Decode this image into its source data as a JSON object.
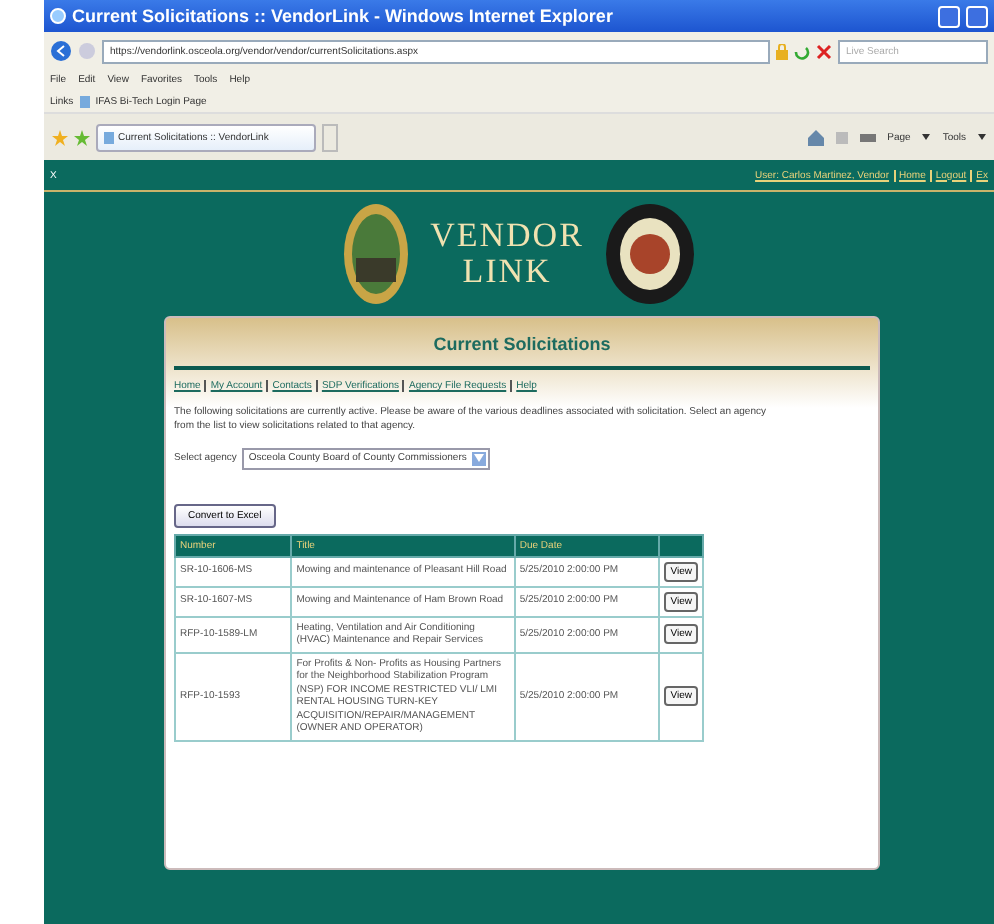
{
  "window": {
    "title": "Current Solicitations :: VendorLink - Windows Internet Explorer"
  },
  "address_bar": {
    "url": "https://vendorlink.osceola.org/vendor/vendor/currentSolicitations.aspx"
  },
  "search": {
    "placeholder": "Live Search"
  },
  "menu": [
    "File",
    "Edit",
    "View",
    "Favorites",
    "Tools",
    "Help"
  ],
  "links_bar": {
    "label": "Links",
    "items": [
      "IFAS Bi-Tech Login Page"
    ]
  },
  "tabs": [
    {
      "label": "Current Solicitations :: VendorLink",
      "selected": true
    }
  ],
  "command_bar": [
    "Page",
    "Tools"
  ],
  "site_header": {
    "mark": "X",
    "user_links": [
      "User: Carlos Martinez, Vendor",
      "Home",
      "Logout",
      "Ex"
    ],
    "logo_lines": [
      "VENDOR",
      "LINK"
    ]
  },
  "panel": {
    "title": "Current Solicitations",
    "nav": [
      "Home",
      "My Account",
      "Contacts",
      "SDP Verifications",
      "Agency File Requests",
      "Help"
    ],
    "intro": "The following solicitations are currently active. Please be aware of the various deadlines associated with solicitation. Select an agency from the list to view solicitations related to that agency.",
    "agency": {
      "label": "Select agency",
      "value": "Osceola County Board of County Commissioners"
    },
    "export_button": "Convert to Excel",
    "table": {
      "columns": [
        "Number",
        "Title",
        "Due Date"
      ],
      "rows": [
        {
          "number": "SR-10-1606-MS",
          "title": "Mowing and maintenance of Pleasant Hill Road",
          "due": "5/25/2010 2:00:00 PM",
          "action": "View"
        },
        {
          "number": "SR-10-1607-MS",
          "title": "Mowing and Maintenance of Ham Brown Road",
          "due": "5/25/2010 2:00:00 PM",
          "action": "View"
        },
        {
          "number": "RFP-10-1589-LM",
          "title": "Heating, Ventilation and Air Conditioning (HVAC) Maintenance and Repair Services",
          "due": "5/25/2010 2:00:00 PM",
          "action": "View"
        },
        {
          "number": "RFP-10-1593",
          "title": "For Profits & Non- Profits as Housing Partners for the Neighborhood Stabilization Program (NSP) FOR INCOME RESTRICTED VLI/ LMI RENTAL HOUSING TURN-KEY ACQUISITION/REPAIR/MANAGEMENT (OWNER AND OPERATOR)",
          "due": "5/25/2010 2:00:00 PM",
          "action": "View"
        }
      ]
    }
  }
}
